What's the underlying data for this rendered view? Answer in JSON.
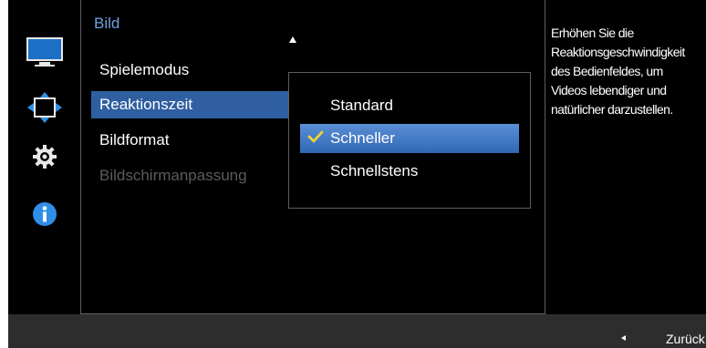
{
  "icons": [
    {
      "name": "picture-icon",
      "selected": false
    },
    {
      "name": "position-icon",
      "selected": false
    },
    {
      "name": "gear-icon",
      "selected": false
    },
    {
      "name": "info-icon",
      "selected": false
    }
  ],
  "panel": {
    "title": "Bild",
    "items": [
      {
        "label": "Spielemodus"
      },
      {
        "label": "Reaktionszeit"
      },
      {
        "label": "Bildformat"
      },
      {
        "label": "Bildschirmanpassung"
      }
    ]
  },
  "submenu": {
    "options": [
      {
        "label": "Standard"
      },
      {
        "label": "Schneller"
      },
      {
        "label": "Schnellstens"
      }
    ],
    "selected": "Schneller",
    "check_color": "#f2d233"
  },
  "info": {
    "lines": [
      "Erhöhen Sie die",
      "Reaktionsgeschwindigkeit",
      "des Bedienfeldes, um",
      "Videos lebendiger und",
      "natürlicher darzustellen."
    ]
  },
  "footer": {
    "back_label": "Zurück"
  },
  "colors": {
    "accent": "#2f5fa1",
    "title": "#6ea0de",
    "disabled": "#5b5b5b"
  }
}
